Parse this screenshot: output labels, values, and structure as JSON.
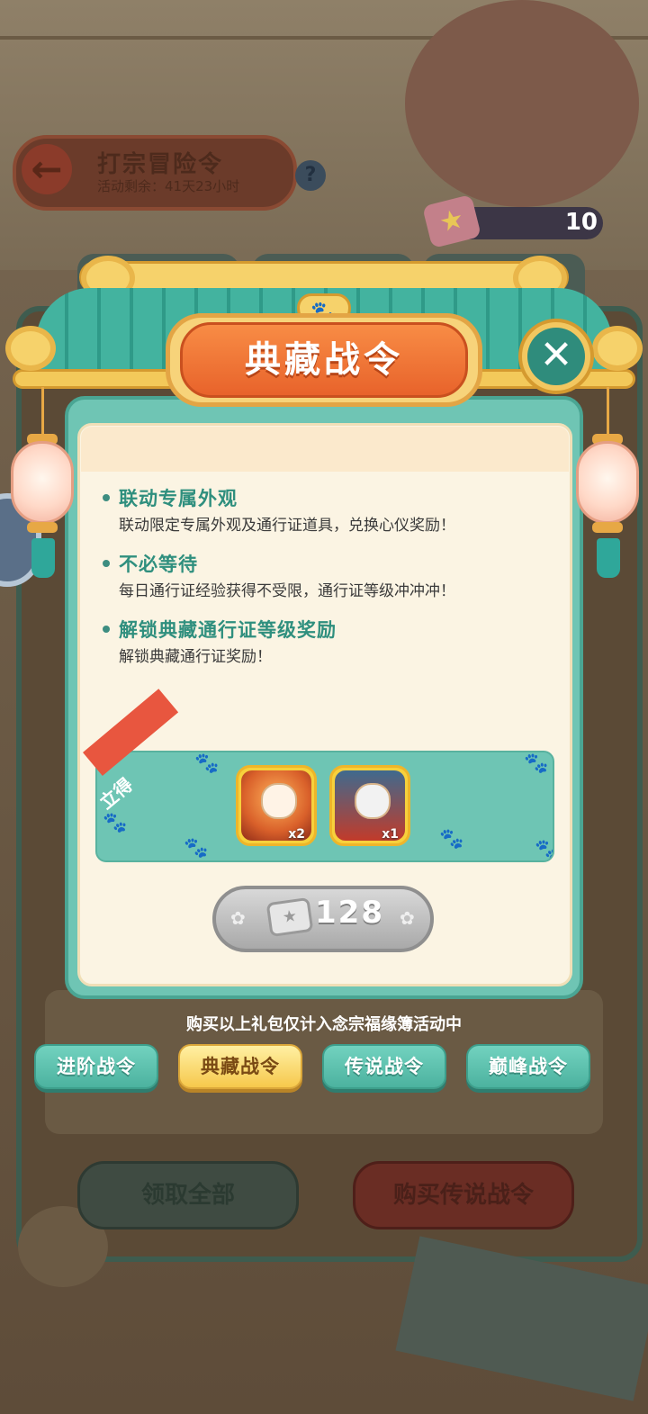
{
  "background": {
    "back_title": "打宗冒险令",
    "back_subtitle": "活动剩余：41天23小时",
    "help_label": "?",
    "currency_value": "10",
    "bottom_left_button": "领取全部",
    "bottom_right_button": "购买传说战令"
  },
  "modal": {
    "title": "典藏战令",
    "close_label": "✕",
    "features": [
      {
        "title": "联动专属外观",
        "desc": "联动限定专属外观及通行证道具，兑换心仪奖励！"
      },
      {
        "title": "不必等待",
        "desc": "每日通行证经验获得不受限，通行证等级冲冲冲！"
      },
      {
        "title": "解锁典藏通行证等级奖励",
        "desc": "解锁典藏通行证奖励！"
      }
    ],
    "reward_ribbon": "立得",
    "rewards": [
      {
        "qty": "x2",
        "icon": "fire-cat-avatar-icon"
      },
      {
        "qty": "x1",
        "icon": "opera-cat-avatar-icon"
      }
    ],
    "price": "128",
    "price_icon": "ticket-icon"
  },
  "note": "购买以上礼包仅计入念宗福缘簿活动中",
  "tabs": [
    {
      "label": "进阶战令",
      "active": false
    },
    {
      "label": "典藏战令",
      "active": true
    },
    {
      "label": "传说战令",
      "active": false
    },
    {
      "label": "巅峰战令",
      "active": false
    }
  ],
  "colors": {
    "accent_teal": "#6fc5b4",
    "title_orange": "#f47a3a",
    "tab_active": "#f6c84c",
    "feature_title": "#2f8f7e"
  }
}
